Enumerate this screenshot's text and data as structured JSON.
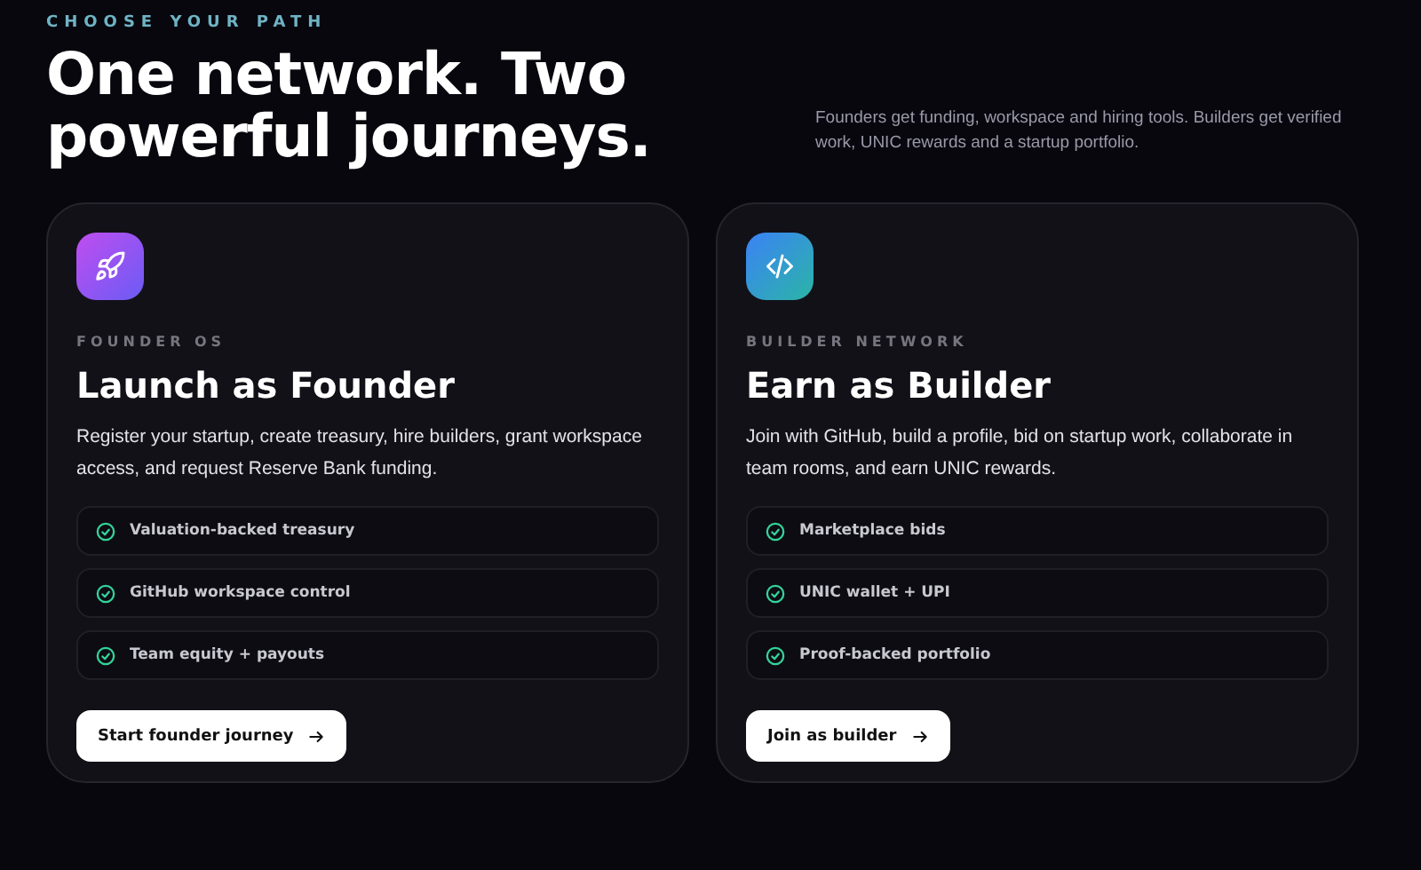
{
  "eyebrow": "CHOOSE YOUR PATH",
  "heading": "One network. Two powerful journeys.",
  "intro": "Founders get funding, workspace and hiring tools. Builders get verified work, UNIC rewards and a startup portfolio.",
  "cards": [
    {
      "kind": "rocket",
      "eyebrow": "FOUNDER OS",
      "title": "Launch as Founder",
      "description": "Register your startup, create treasury, hire builders, grant workspace access, and request Reserve Bank funding.",
      "features": [
        "Valuation-backed treasury",
        "GitHub workspace control",
        "Team equity + payouts"
      ],
      "button": "Start founder journey"
    },
    {
      "kind": "code",
      "eyebrow": "BUILDER NETWORK",
      "title": "Earn as Builder",
      "description": "Join with GitHub, build a profile, bid on startup work, collaborate in team rooms, and earn UNIC rewards.",
      "features": [
        "Marketplace bids",
        "UNIC wallet + UPI",
        "Proof-backed portfolio"
      ],
      "button": "Join as builder"
    }
  ]
}
